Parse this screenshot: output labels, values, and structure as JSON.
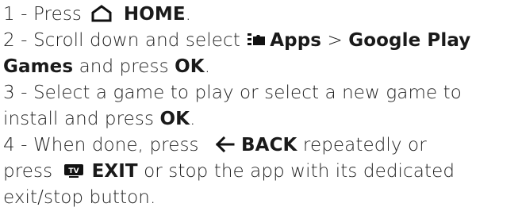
{
  "steps": [
    {
      "n": "1 -",
      "t1": "Press",
      "b1": "HOME",
      "t2": "."
    },
    {
      "n": "2 -",
      "t1": "Scroll down and select",
      "b1": "Apps",
      "t2": " > ",
      "b2": "Google Play",
      "b3": "Games",
      "t3": " and press ",
      "b4": "OK",
      "t4": "."
    },
    {
      "n": "3 -",
      "t1": "Select a game to play or select a new game to",
      "t2": "install and press ",
      "b1": "OK",
      "t3": "."
    },
    {
      "n": "4 -",
      "t1": "When done, press",
      "b1": "BACK",
      "t2": " repeatedly or",
      "t3": "press",
      "b2": "EXIT",
      "t4": " or stop the app with its dedicated",
      "t5": "exit/stop button."
    }
  ],
  "icons": {
    "home": "home-icon",
    "apps": "apps-icon",
    "back": "back-arrow-icon",
    "tv": "tv-icon"
  },
  "colors": {
    "text": "#222222",
    "icon": "#111111"
  }
}
